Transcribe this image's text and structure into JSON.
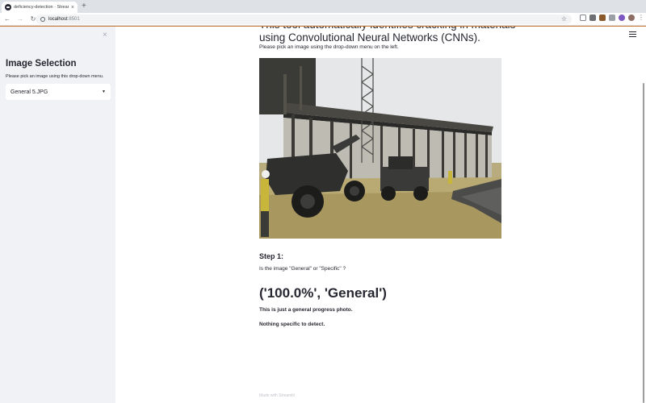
{
  "browser": {
    "tab_title": "deficiency-detection · Streamlit",
    "url_host": "localhost",
    "url_port": ":8501",
    "tab_close_glyph": "×",
    "newtab_glyph": "+",
    "star_glyph": "☆",
    "menu_glyph": "⋮"
  },
  "sidebar": {
    "close_glyph": "×",
    "title": "Image Selection",
    "caption": "Please pick an image using this drop-down menu.",
    "select_value": "General 5.JPG",
    "select_caret": "▼"
  },
  "main": {
    "title": "This tool automatically identifies cracking in materials using Convolutional Neural Networks (CNNs).",
    "instruction": "Please pick an image using the drop-down menu on the left.",
    "step_heading": "Step 1:",
    "step_question": "Is the image \"General\" or \"Specific\" ?",
    "result": "('100.0%', 'General')",
    "message_1": "This is just a general progress photo.",
    "message_2": "Nothing specific to detect.",
    "footer": "Made with Streamlit"
  },
  "colors": {
    "sidebar_bg": "#f0f2f6",
    "text": "#262730",
    "chrome_bg": "#dee1e6",
    "loading_accent": "#c9772e"
  }
}
